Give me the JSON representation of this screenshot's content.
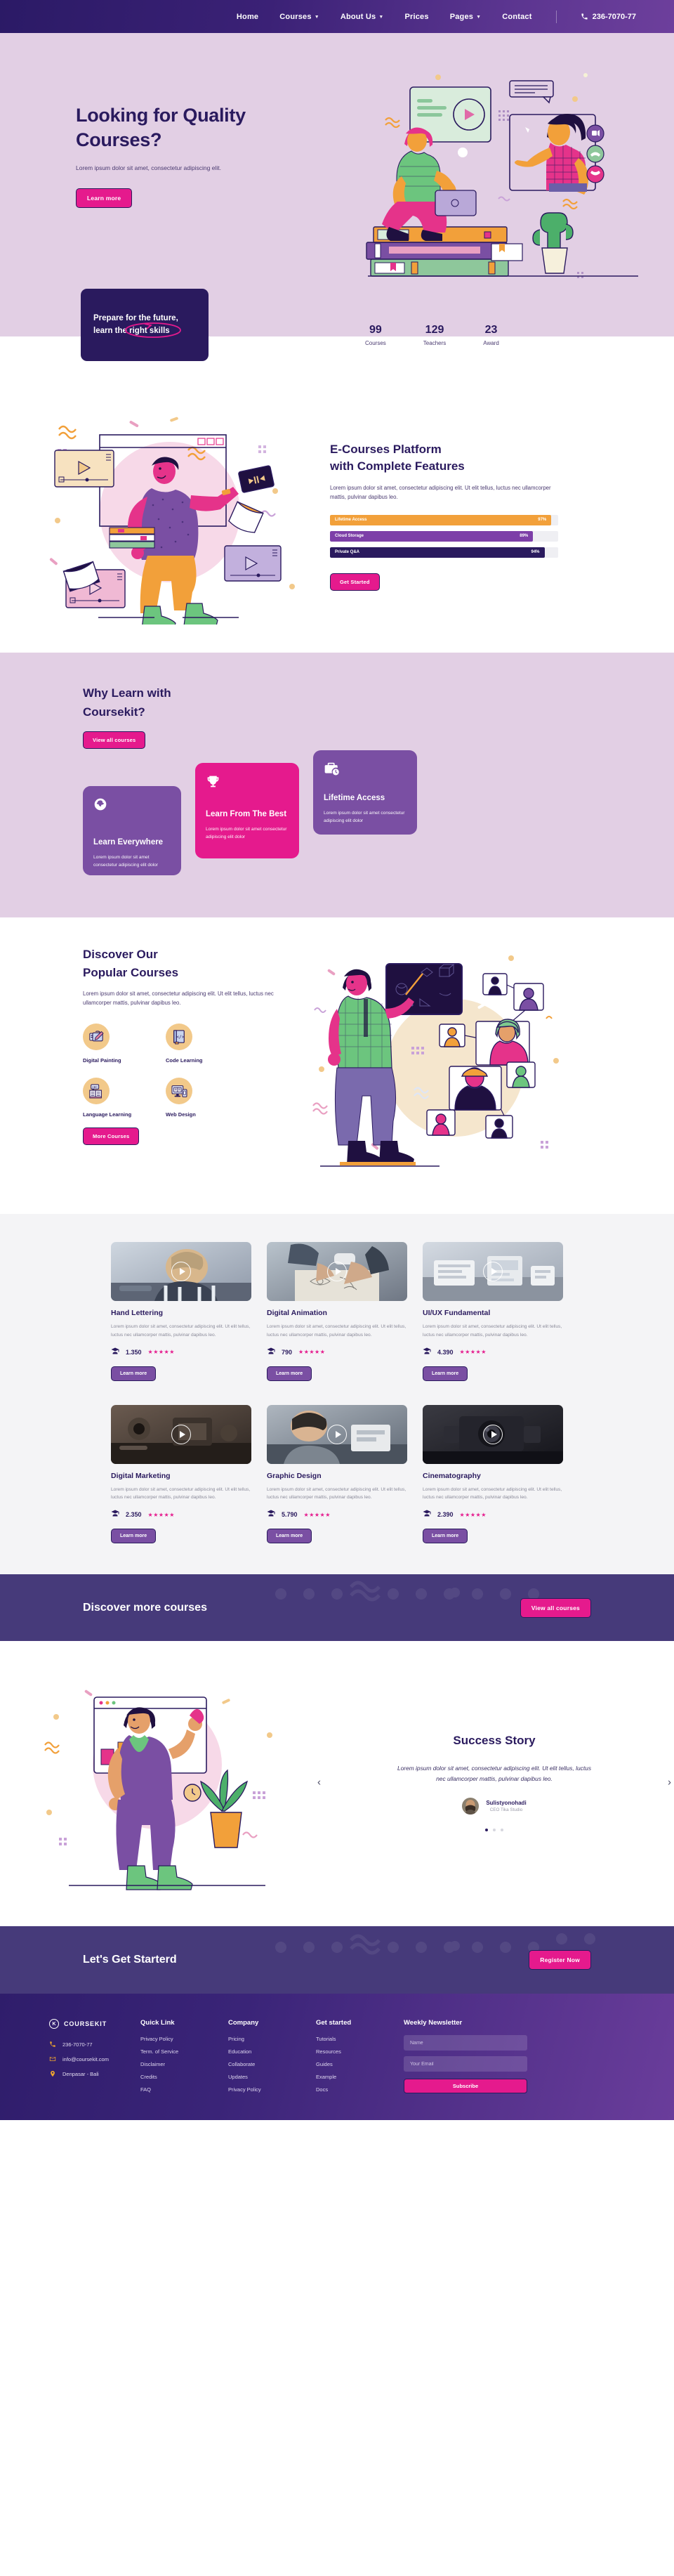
{
  "nav": {
    "items": [
      {
        "label": "Home",
        "caret": false
      },
      {
        "label": "Courses",
        "caret": true
      },
      {
        "label": "About Us",
        "caret": true
      },
      {
        "label": "Prices",
        "caret": false
      },
      {
        "label": "Pages",
        "caret": true
      },
      {
        "label": "Contact",
        "caret": false
      }
    ],
    "phone": "236-7070-77"
  },
  "hero": {
    "title": "Looking for Quality Courses?",
    "subtitle": "Lorem ipsum dolor sit amet, consectetur adipiscing elit.",
    "cta": "Learn more"
  },
  "skillcard": {
    "line1": "Prepare for the future,",
    "line2_pre": "learn the ",
    "line2_circled": "right skills"
  },
  "stats": [
    {
      "num": "99",
      "label": "Courses"
    },
    {
      "num": "129",
      "label": "Teachers"
    },
    {
      "num": "23",
      "label": "Award"
    }
  ],
  "ecourses": {
    "title_l1": "E-Courses Platform",
    "title_l2": "with Complete Features",
    "lead": "Lorem ipsum dolor sit amet, consectetur adipiscing elit. Ut elit tellus, luctus nec ullamcorper mattis, pulvinar dapibus leo.",
    "cta": "Get Started",
    "bars": [
      {
        "label": "Lifetime Access",
        "value": 97,
        "value_label": "97%",
        "color": "#f2a03a"
      },
      {
        "label": "Cloud Storage",
        "value": 89,
        "value_label": "89%",
        "color": "#7d3fa8"
      },
      {
        "label": "Private Q&A",
        "value": 94,
        "value_label": "94%",
        "color": "#2a1a5e"
      }
    ]
  },
  "why": {
    "title_l1": "Why Learn with",
    "title_l2": "Coursekit?",
    "cta": "View all courses",
    "cards": [
      {
        "icon": "globe-icon",
        "title": "Learn Everywhere",
        "text": "Lorem ipsum dolor sit amet consectetur adipiscing elit dolor",
        "color": "#7a4fa3"
      },
      {
        "icon": "trophy-icon",
        "title": "Learn From The Best",
        "text": "Lorem ipsum dolor sit amet consectetur adipiscing elit dolor",
        "color": "#e51a8d"
      },
      {
        "icon": "briefcase-clock-icon",
        "title": "Lifetime Access",
        "text": "Lorem ipsum dolor sit amet consectetur adipiscing elit dolor",
        "color": "#7a4fa3"
      }
    ]
  },
  "discover": {
    "title_l1": "Discover Our",
    "title_l2": "Popular Courses",
    "lead": "Lorem ipsum dolor sit amet, consectetur adipiscing elit. Ut elit tellus, luctus nec ullamcorper mattis, pulvinar dapibus leo.",
    "cta": "More Courses",
    "categories": [
      {
        "name": "Digital Painting",
        "icon": "tablet-pen-icon"
      },
      {
        "name": "Code Learning",
        "icon": "code-book-icon"
      },
      {
        "name": "Language Learning",
        "icon": "abc-book-icon"
      },
      {
        "name": "Web Design",
        "icon": "monitor-phone-icon"
      }
    ]
  },
  "courses": {
    "desc": "Lorem ipsum dolor sit amet, consectetur adipiscing elit. Ut elit tellus, luctus nec ullamcorper mattis, pulvinar dapibus leo.",
    "cta": "Learn more",
    "stars": "★★★★★",
    "row1": [
      {
        "title": "Hand Lettering",
        "count": "1.350"
      },
      {
        "title": "Digital Animation",
        "count": "790"
      },
      {
        "title": "UI/UX Fundamental",
        "count": "4.390"
      }
    ],
    "row2": [
      {
        "title": "Digital Marketing",
        "count": "2.350"
      },
      {
        "title": "Graphic Design",
        "count": "5.790"
      },
      {
        "title": "Cinematography",
        "count": "2.390"
      }
    ]
  },
  "banner": {
    "title": "Discover more courses",
    "cta": "View all courses"
  },
  "success": {
    "title": "Success Story",
    "quote": "Lorem ipsum dolor sit amet, consectetur adipiscing elit. Ut elit tellus, luctus nec ullamcorper mattis, pulvinar dapibus leo.",
    "author_name": "Sulistyonohadi",
    "author_role": "CEO Tika Studio",
    "prev": "‹",
    "next": "›"
  },
  "cta": {
    "title": "Let's Get Starterd",
    "button": "Register Now"
  },
  "footer": {
    "brand": "COURSEKIT",
    "logo_letter": "K",
    "phone": "236-7070-77",
    "email": "info@coursekit.com",
    "address": "Denpasar - Bali",
    "columns": [
      {
        "heading": "Quick Link",
        "links": [
          "Privacy Policy",
          "Term. of Service",
          "Disclaimer",
          "Credits",
          "FAQ"
        ]
      },
      {
        "heading": "Company",
        "links": [
          "Pricing",
          "Education",
          "Collaborate",
          "Updates",
          "Privacy Policy"
        ]
      },
      {
        "heading": "Get started",
        "links": [
          "Tutorials",
          "Resources",
          "Guides",
          "Example",
          "Docs"
        ]
      }
    ],
    "newsletter": {
      "heading": "Weekly Newsletter",
      "name_placeholder": "Name",
      "email_placeholder": "Your Email",
      "button": "Subscribe"
    }
  },
  "colors": {
    "navy": "#2a1a5e",
    "pink": "#e51a8d",
    "purple": "#7a4fa3",
    "lavender": "#e2cfe4",
    "orange": "#f2a03a"
  }
}
